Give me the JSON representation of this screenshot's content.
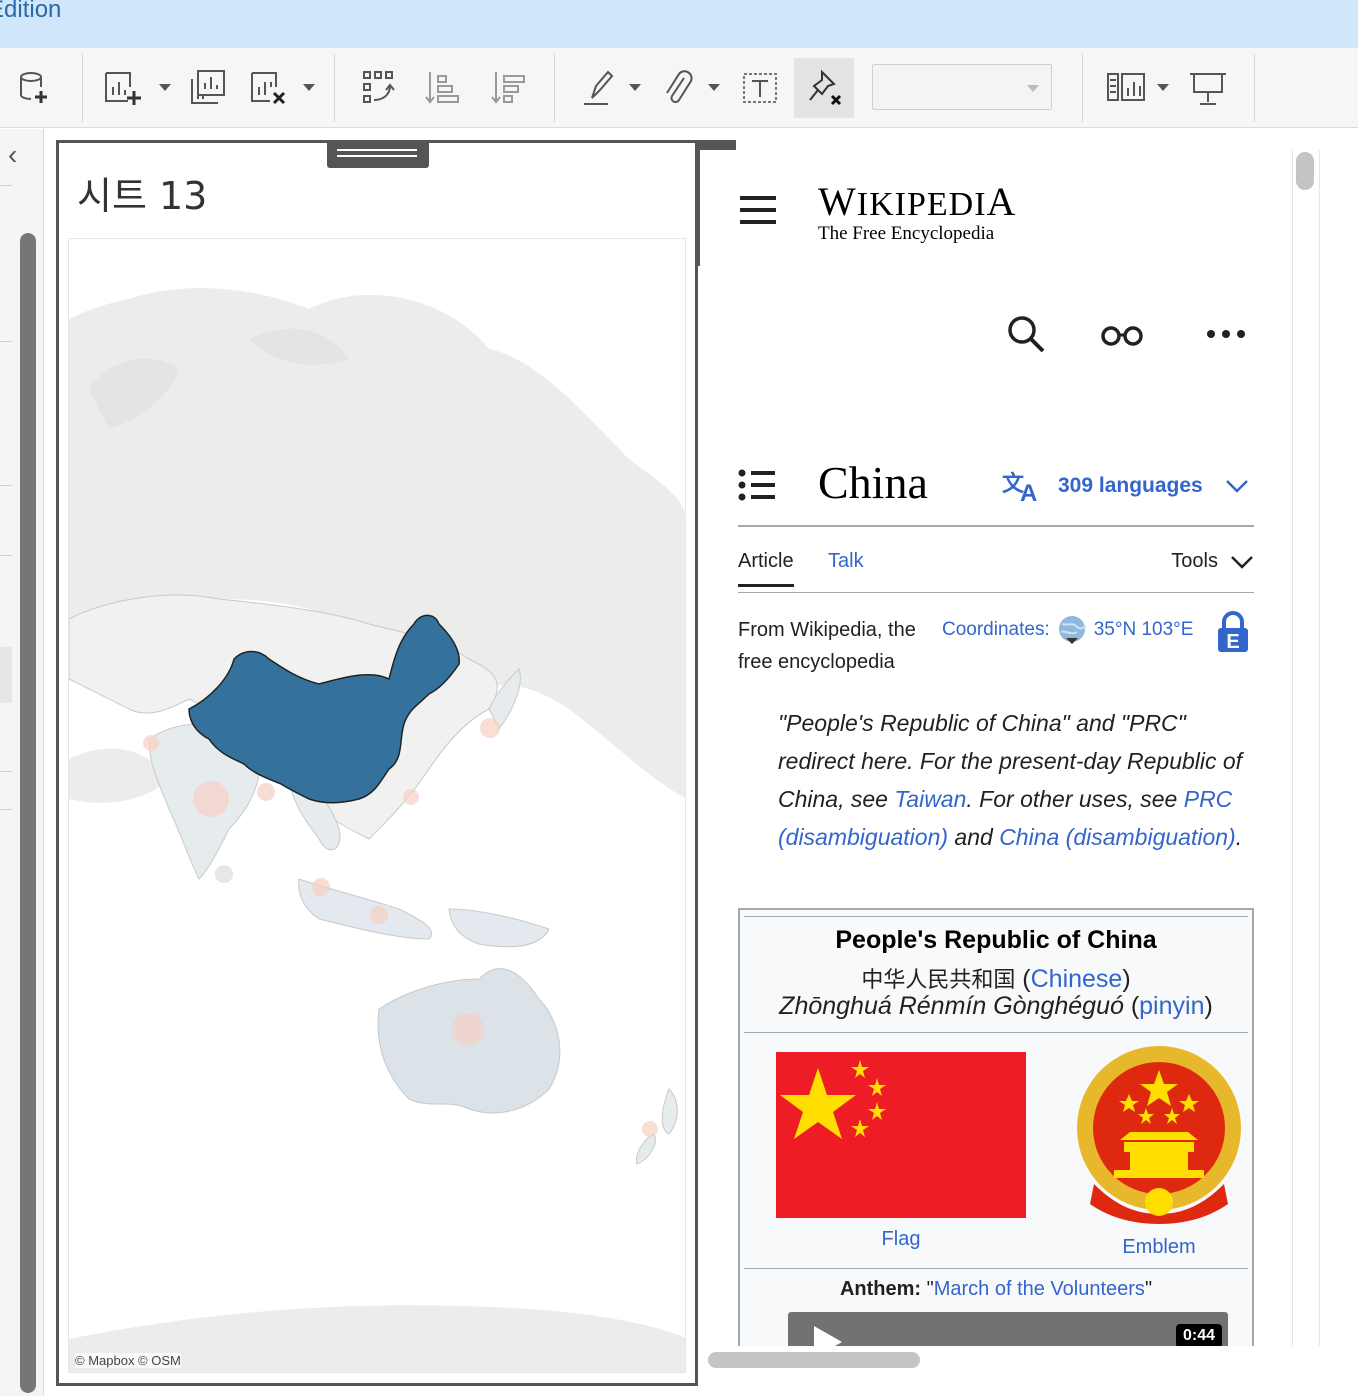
{
  "app": {
    "title": "Edition"
  },
  "toolbar": {
    "icons": [
      "new-data-source-icon",
      "new-worksheet-icon",
      "duplicate-sheet-icon",
      "clear-sheet-icon",
      "swap-rows-columns-icon",
      "sort-ascending-icon",
      "sort-descending-icon",
      "highlight-icon",
      "attachment-icon",
      "text-label-icon",
      "unpin-icon",
      "presentation-view-icon",
      "show-cards-icon"
    ],
    "dropdown_value": ""
  },
  "sheet": {
    "title": "시트 13",
    "map_attribution": "© Mapbox © OSM",
    "highlight_color": "#34729d"
  },
  "wiki": {
    "logo_wordmark": "Wikipedia",
    "logo_tagline": "The Free Encyclopedia",
    "article_title": "China",
    "languages_label": "309 languages",
    "tabs": {
      "article": "Article",
      "talk": "Talk",
      "tools": "Tools"
    },
    "from_line": "From Wikipedia, the free encyclopedia",
    "coordinates_label": "Coordinates",
    "coordinates_value": "35°N 103°E",
    "hatnote": {
      "p1": "\"People's Republic of China\" and \"PRC\" redirect here. For the present-day Republic of China, see ",
      "link_taiwan": "Taiwan",
      "p2": ". For other uses, see ",
      "link_prc": "PRC (disambiguation)",
      "p3": " and ",
      "link_china": "China (disambiguation)",
      "p4": "."
    },
    "infobox": {
      "name": "People's Republic of China",
      "native_name": "中华人民共和国",
      "native_lang": "Chinese",
      "pinyin_name": "Zhōnghuá Rénmín Gònghéguó",
      "pinyin_label": "pinyin",
      "flag_caption": "Flag",
      "emblem_caption": "Emblem",
      "anthem_label": "Anthem:",
      "anthem_title": "March of the Volunteers",
      "audio_duration": "0:44"
    },
    "link_color": "#3366cc"
  }
}
